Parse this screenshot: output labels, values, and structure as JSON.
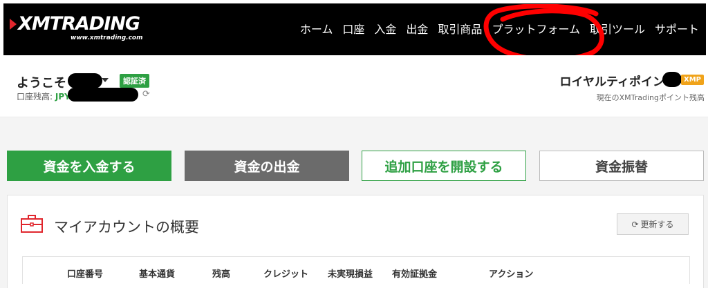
{
  "header": {
    "logo_text": "XMTRADING",
    "logo_url": "www.xmtrading.com",
    "nav": [
      "ホーム",
      "口座",
      "入金",
      "出金",
      "取引商品",
      "プラットフォーム",
      "取引ツール",
      "サポート"
    ]
  },
  "account": {
    "welcome": "ようこそ",
    "verified": "認証済",
    "balance_label": "口座残高:",
    "currency": "JPY",
    "loyalty_title": "ロイヤルティポイント",
    "xmp_badge": "XMP",
    "loyalty_sub": "現在のXMTradingポイント残高"
  },
  "actions": {
    "deposit": "資金を入金する",
    "withdraw": "資金の出金",
    "open_account": "追加口座を開設する",
    "transfer": "資金振替"
  },
  "overview": {
    "title": "マイアカウントの概要",
    "refresh": "更新する",
    "columns": [
      "口座番号",
      "基本通貨",
      "残高",
      "クレジット",
      "未実現損益",
      "有効証拠金",
      "アクション"
    ]
  },
  "colors": {
    "accent_green": "#2ea043",
    "xmp_orange": "#f0a31a",
    "logo_red": "#e0262d",
    "annotation_red": "#ff0000"
  }
}
